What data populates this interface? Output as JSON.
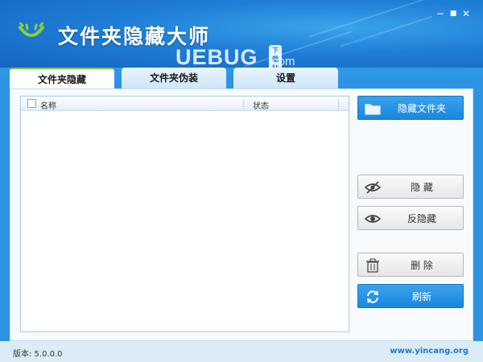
{
  "app": {
    "title": "文件夹隐藏大师",
    "watermark": "UEBUG",
    "watermark_suffix": ".com",
    "watermark_badge": "下载站"
  },
  "window_controls": {
    "minimize": "−",
    "maximize": "■",
    "close": "✕"
  },
  "tabs": [
    {
      "label": "文件夹隐藏",
      "active": true
    },
    {
      "label": "文件夹伪装",
      "active": false
    },
    {
      "label": "设置",
      "active": false
    }
  ],
  "list": {
    "columns": [
      "名称",
      "状态"
    ],
    "rows": []
  },
  "buttons": {
    "hide_folder": "隐藏文件夹",
    "hide": "隐 藏",
    "unhide": "反隐藏",
    "delete": "删 除",
    "refresh": "刷新"
  },
  "status": {
    "version": "版本: 5.0.0.0",
    "site": "www.yincang.org"
  },
  "colors": {
    "accent": "#1a86dc",
    "tab_active_indicator": "#7cc63a",
    "title_bg": "#1f7fd6"
  }
}
